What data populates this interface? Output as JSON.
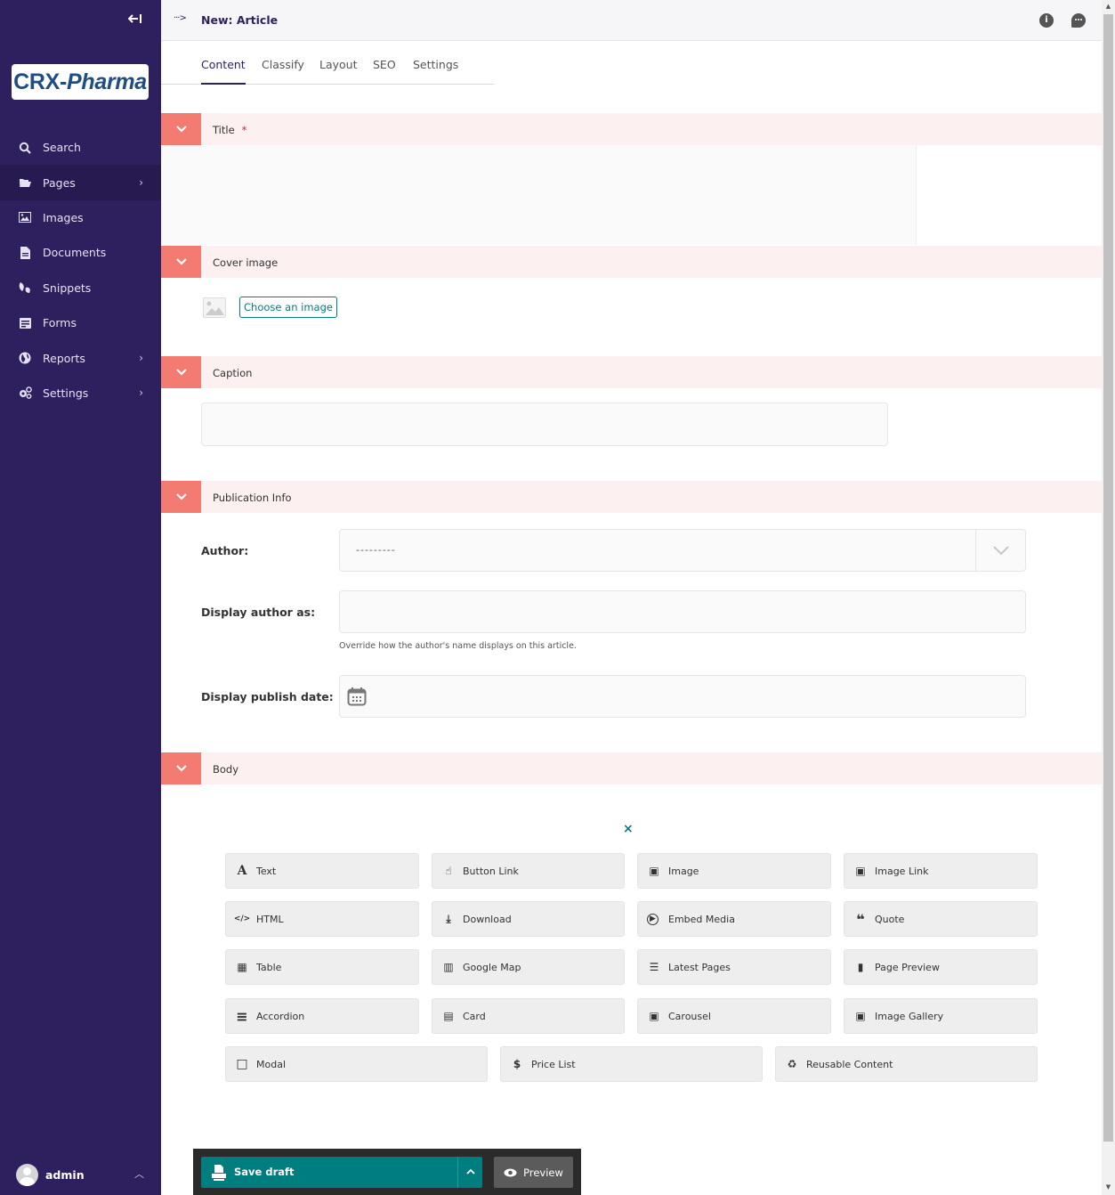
{
  "sidebar": {
    "collapse_icon": "arrow-left-bar-icon",
    "logo": {
      "part1": "CRX-",
      "part2": "Pharma"
    },
    "items": [
      {
        "label": "Search",
        "icon": "search-icon",
        "has_submenu": false,
        "active": false
      },
      {
        "label": "Pages",
        "icon": "folder-open-icon",
        "has_submenu": true,
        "active": true
      },
      {
        "label": "Images",
        "icon": "image-icon",
        "has_submenu": false,
        "active": false
      },
      {
        "label": "Documents",
        "icon": "document-icon",
        "has_submenu": false,
        "active": false
      },
      {
        "label": "Snippets",
        "icon": "snippet-icon",
        "has_submenu": false,
        "active": false
      },
      {
        "label": "Forms",
        "icon": "form-icon",
        "has_submenu": false,
        "active": false
      },
      {
        "label": "Reports",
        "icon": "globe-icon",
        "has_submenu": true,
        "active": false
      },
      {
        "label": "Settings",
        "icon": "cogs-icon",
        "has_submenu": true,
        "active": false
      }
    ],
    "user": {
      "name": "admin"
    }
  },
  "header": {
    "breadcrumb_toggle": "···>",
    "title": "New: Article",
    "info_icon": "i",
    "comment_icon": "···"
  },
  "tabs": [
    {
      "label": "Content",
      "active": true
    },
    {
      "label": "Classify",
      "active": false
    },
    {
      "label": "Layout",
      "active": false
    },
    {
      "label": "SEO",
      "active": false
    },
    {
      "label": "Settings",
      "active": false
    }
  ],
  "sections": {
    "title": {
      "label": "Title",
      "required_mark": "*",
      "value": ""
    },
    "cover_image": {
      "label": "Cover image",
      "choose_button": "Choose an image"
    },
    "caption": {
      "label": "Caption",
      "value": ""
    },
    "publication_info": {
      "label": "Publication Info",
      "author": {
        "label": "Author:",
        "value": "---------"
      },
      "display_author": {
        "label": "Display author as:",
        "value": "",
        "help": "Override how the author's name displays on this article."
      },
      "publish_date": {
        "label": "Display publish date:",
        "value": ""
      }
    },
    "body": {
      "label": "Body",
      "close_icon": "×",
      "blocks": [
        {
          "label": "Text",
          "icon": "A"
        },
        {
          "label": "Button Link",
          "icon": "☝"
        },
        {
          "label": "Image",
          "icon": "▣"
        },
        {
          "label": "Image Link",
          "icon": "▣"
        },
        {
          "label": "HTML",
          "icon": "</>"
        },
        {
          "label": "Download",
          "icon": "⤓"
        },
        {
          "label": "Embed Media",
          "icon": "▶"
        },
        {
          "label": "Quote",
          "icon": "❝"
        },
        {
          "label": "Table",
          "icon": "▦"
        },
        {
          "label": "Google Map",
          "icon": "▥"
        },
        {
          "label": "Latest Pages",
          "icon": "☰"
        },
        {
          "label": "Page Preview",
          "icon": "▮"
        },
        {
          "label": "Accordion",
          "icon": "≡"
        },
        {
          "label": "Card",
          "icon": "▤"
        },
        {
          "label": "Carousel",
          "icon": "▣"
        },
        {
          "label": "Image Gallery",
          "icon": "▣"
        },
        {
          "label": "Modal",
          "icon": "□"
        },
        {
          "label": "Price List",
          "icon": "$"
        },
        {
          "label": "Reusable Content",
          "icon": "♻"
        }
      ]
    }
  },
  "footer": {
    "save_label": "Save draft",
    "more_icon": "^",
    "preview_label": "Preview"
  },
  "colors": {
    "sidebar_bg": "#2e1f5e",
    "section_toggle": "#f37b72",
    "section_header_bg": "#fcf0f0",
    "primary_teal": "#007d7e"
  }
}
